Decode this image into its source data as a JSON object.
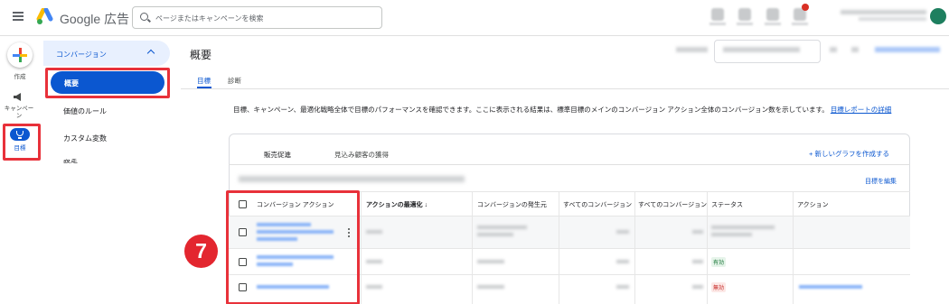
{
  "app": {
    "product_name": "Google 広告"
  },
  "search": {
    "placeholder": "ページまたはキャンペーンを検索"
  },
  "rail": {
    "create_label": "作成",
    "campaign_label": "キャンペーン",
    "goals_label": "目標"
  },
  "menu": {
    "section_label": "コンバージョン",
    "items": [
      "概要",
      "価値のルール",
      "カスタム変数",
      "設定"
    ]
  },
  "main": {
    "title": "概要",
    "tabs": [
      "目標",
      "診断"
    ],
    "description": "目標、キャンペーン、最適化戦略全体で目標のパフォーマンスを確認できます。ここに表示される結果は、標準目標のメインのコンバージョン アクション全体のコンバージョン数を示しています。",
    "description_link": "目標レポートの詳細"
  },
  "card": {
    "chart_tabs": [
      "販売促進",
      "見込み顧客の獲得"
    ],
    "new_graph": "+ 新しいグラフを作成する",
    "edit_goals": "目標を編集"
  },
  "table": {
    "columns": [
      "コンバージョン アクション",
      "アクションの最適化 ↓",
      "コンバージョンの発生元",
      "すべてのコンバージョン",
      "すべてのコンバージョン",
      "ステータス",
      "アクション"
    ],
    "status": [
      "有効",
      "無効"
    ]
  },
  "annotation": {
    "step": "7"
  },
  "colors": {
    "accent": "#0b57d0",
    "highlight": "#e8313a",
    "badge": "#e3262f"
  }
}
